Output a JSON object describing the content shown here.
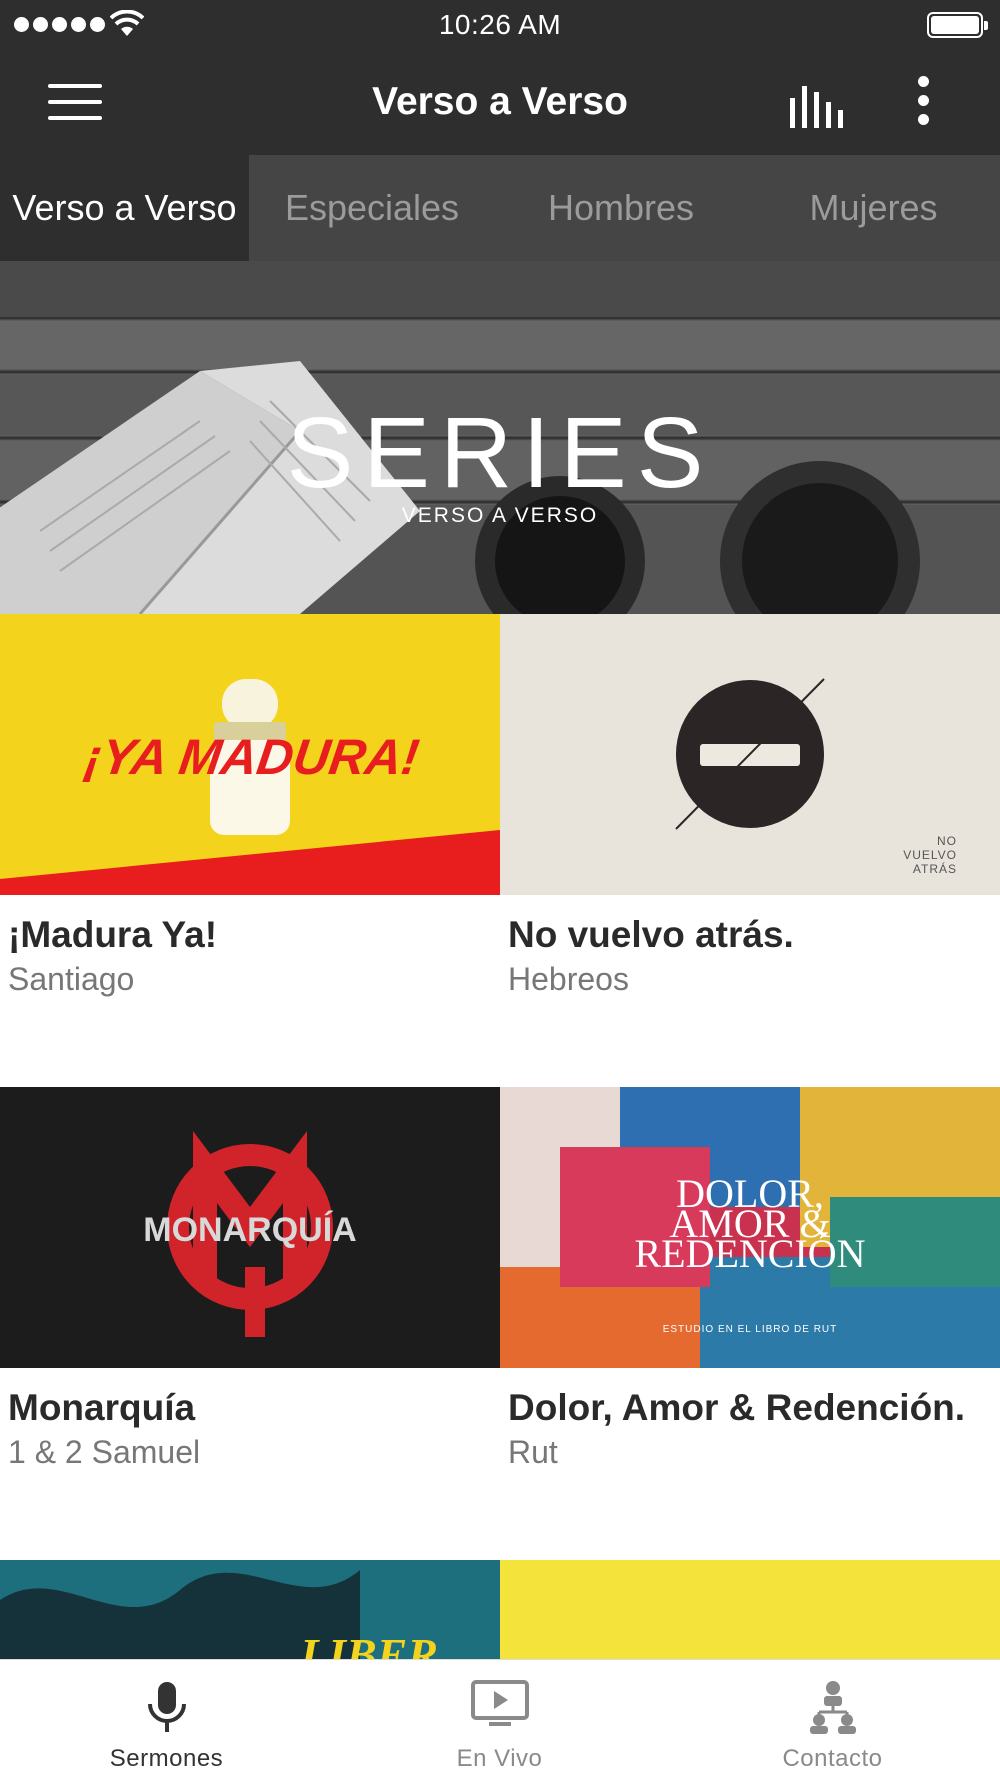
{
  "status_bar": {
    "time": "10:26 AM",
    "signal_icon": "signal-dots-icon",
    "wifi_icon": "wifi-icon",
    "battery_icon": "battery-icon"
  },
  "app_bar": {
    "title": "Verso a Verso",
    "menu_icon": "hamburger-menu-icon",
    "audio_icon": "audio-bars-icon",
    "more_icon": "more-vertical-icon"
  },
  "tabs": [
    {
      "label": "Verso a Verso",
      "active": true
    },
    {
      "label": "Especiales",
      "active": false
    },
    {
      "label": "Hombres",
      "active": false
    },
    {
      "label": "Mujeres",
      "active": false
    }
  ],
  "banner": {
    "title": "SERIES",
    "subtitle": "VERSO A VERSO"
  },
  "series": [
    {
      "title": "¡Madura Ya!",
      "subtitle": "Santiago",
      "art_text": "¡YA MADURA!",
      "art_bg": "#f4d31d"
    },
    {
      "title": "No vuelvo atrás.",
      "subtitle": "Hebreos",
      "art_text_lines": [
        "NO",
        "VUELVO",
        "ATRÁS"
      ],
      "art_bg": "#e8e4dc"
    },
    {
      "title": "Monarquía",
      "subtitle": "1 & 2 Samuel",
      "art_text": "MONARQUÍA",
      "art_bg": "#1d1c1c"
    },
    {
      "title": "Dolor, Amor & Redención.",
      "subtitle": "Rut",
      "art_text_lines": [
        "DOLOR,",
        "AMOR &",
        "REDENCIÓN"
      ],
      "art_caption": "ESTUDIO EN EL LIBRO DE RUT",
      "art_bg": "#c8324f"
    },
    {
      "art_text": "LIBER",
      "art_bg": "#1e6f7e"
    },
    {
      "art_bg": "#f4e33a"
    }
  ],
  "bottom_nav": [
    {
      "label": "Sermones",
      "icon": "microphone-icon",
      "active": true
    },
    {
      "label": "En Vivo",
      "icon": "tv-play-icon",
      "active": false
    },
    {
      "label": "Contacto",
      "icon": "people-network-icon",
      "active": false
    }
  ],
  "colors": {
    "header_bg": "#2e2e2e",
    "tab_bar_bg": "#454545",
    "tab_inactive_text": "#9b9b9b",
    "accent_red": "#e81e1e"
  }
}
